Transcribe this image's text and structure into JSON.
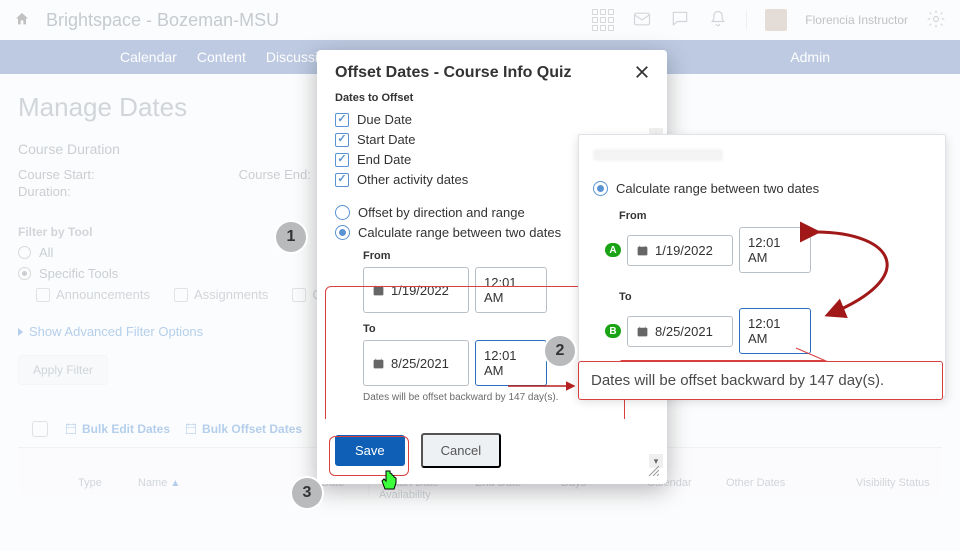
{
  "topbar": {
    "brand": "Brightspace - Bozeman-MSU",
    "username": "Florencia Instructor"
  },
  "nav": {
    "calendar": "Calendar",
    "content": "Content",
    "discussions": "Discussions",
    "truncated": "A",
    "admin": "Admin"
  },
  "page": {
    "title": "Manage Dates",
    "course_duration_h": "Course Duration",
    "course_start": "Course Start:",
    "course_end": "Course End:",
    "duration": "Duration:",
    "filter_h": "Filter by Tool",
    "filter_all": "All",
    "filter_specific": "Specific Tools",
    "tool_announcements": "Announcements",
    "tool_assignments": "Assignments",
    "tool_calendar": "Calendar",
    "advanced": "Show Advanced Filter Options",
    "apply": "Apply Filter",
    "bulk_edit": "Bulk Edit Dates",
    "bulk_offset": "Bulk Offset Dates"
  },
  "table": {
    "type": "Type",
    "name": "Name",
    "due": "Due Date",
    "availability": "Availability",
    "start": "Start Date",
    "end": "End Date",
    "days": "Days",
    "calendar": "Calendar",
    "other": "Other Dates",
    "visibility": "Visibility Status"
  },
  "modal": {
    "title": "Offset Dates - Course Info Quiz",
    "dates_to_offset": "Dates to Offset",
    "due_date": "Due Date",
    "start_date": "Start Date",
    "end_date": "End Date",
    "other_activity": "Other activity dates",
    "opt_direction": "Offset by direction and range",
    "opt_calculate": "Calculate range between two dates",
    "from": "From",
    "to": "To",
    "from_date": "1/19/2022",
    "from_time": "12:01 AM",
    "to_date": "8/25/2021",
    "to_time": "12:01 AM",
    "note": "Dates will be offset backward by 147 day(s).",
    "save": "Save",
    "cancel": "Cancel"
  },
  "callout": {
    "opt_calculate": "Calculate range between two dates",
    "from": "From",
    "to": "To",
    "from_date": "1/19/2022",
    "from_time": "12:01 AM",
    "to_date": "8/25/2021",
    "to_time": "12:01 AM",
    "note": "Dates will be offset backward by 147 day(s).",
    "pillA": "A",
    "pillB": "B",
    "big_note": "Dates will be offset backward by 147 day(s)."
  },
  "steps": {
    "s1": "1",
    "s2": "2",
    "s3": "3"
  }
}
